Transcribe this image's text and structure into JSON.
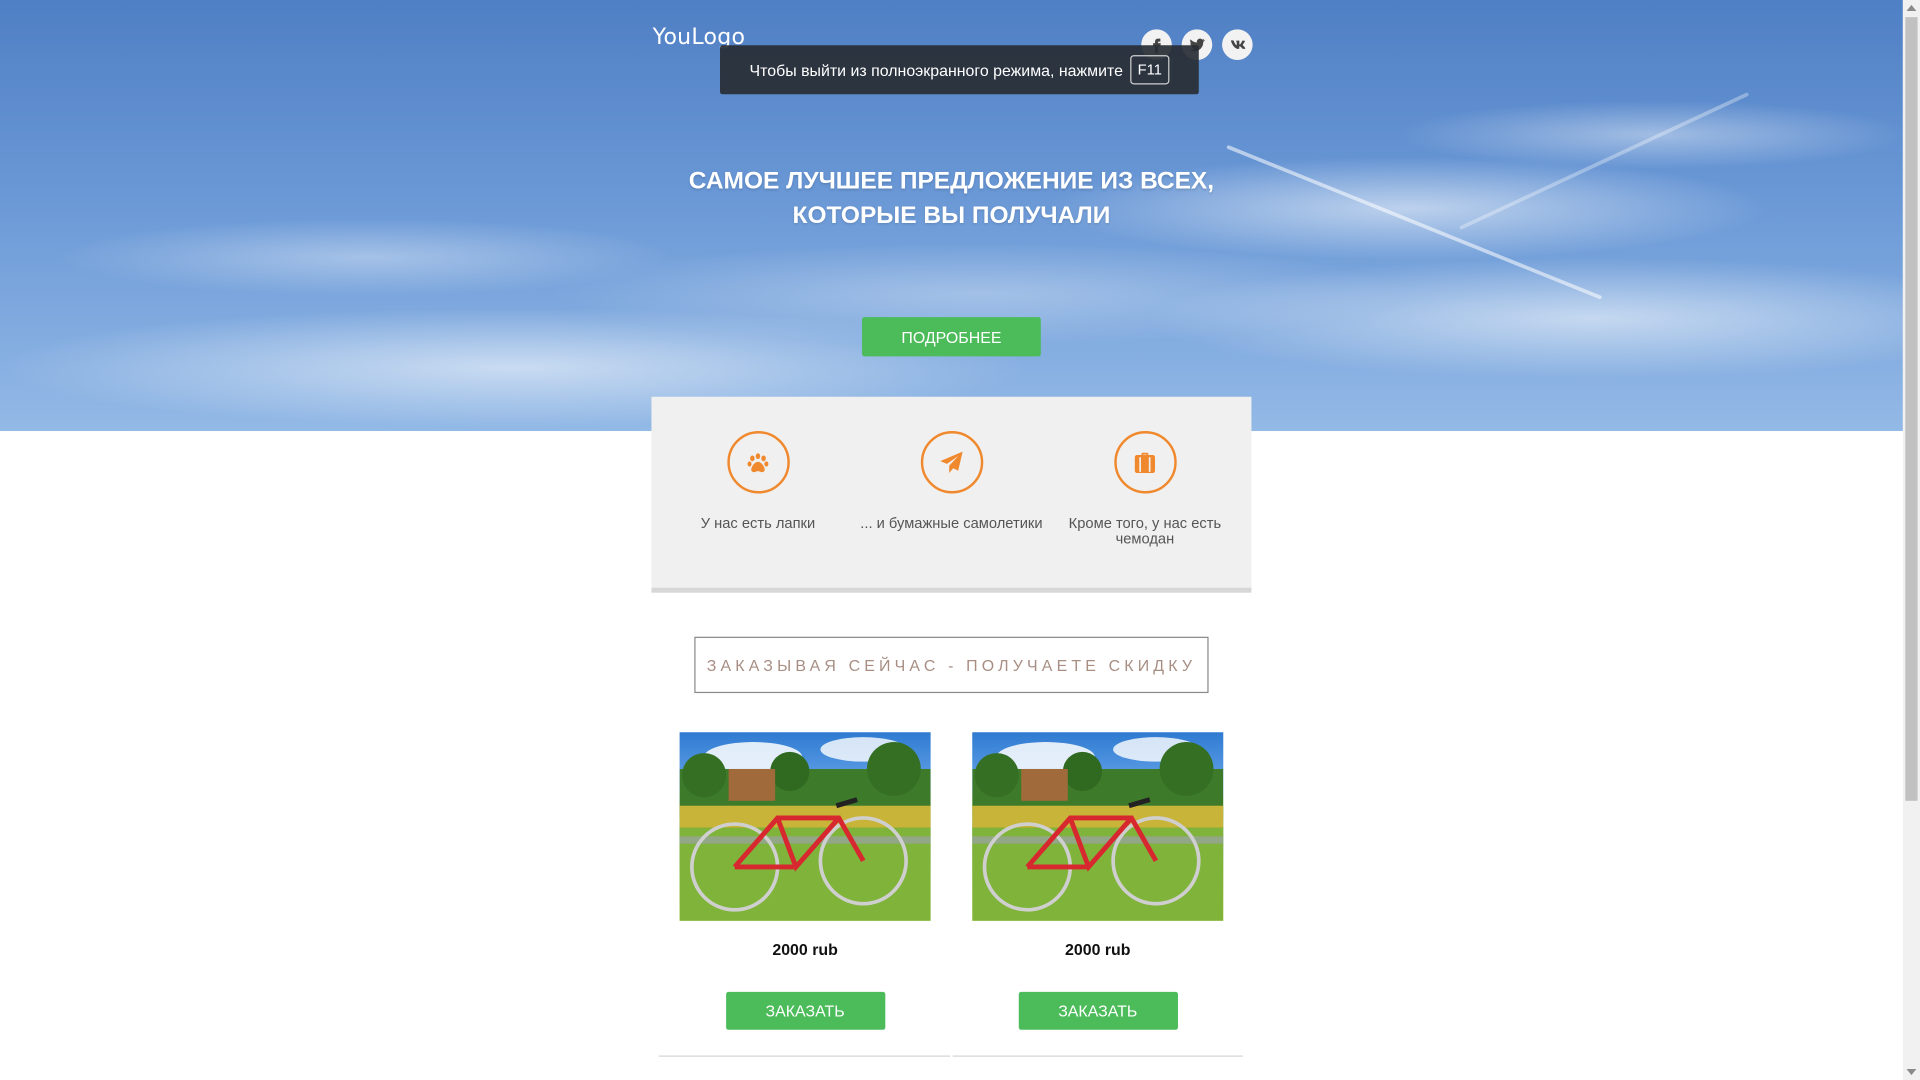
{
  "header": {
    "logo": "YouLogo",
    "social": [
      {
        "icon": "facebook-icon"
      },
      {
        "icon": "twitter-icon"
      },
      {
        "icon": "vk-icon"
      }
    ]
  },
  "fullscreen_notice": {
    "text": "Чтобы выйти из полноэкранного режима, нажмите",
    "key": "F11"
  },
  "hero": {
    "headline_line1": "САМОЕ ЛУЧШЕЕ ПРЕДЛОЖЕНИЕ ИЗ ВСЕХ,",
    "headline_line2": "КОТОРЫЕ ВЫ ПОЛУЧАЛИ",
    "button_label": "ПОДРОБНЕЕ"
  },
  "features": [
    {
      "icon": "paw-icon",
      "text": "У нас есть лапки"
    },
    {
      "icon": "paper-plane-icon",
      "text": "... и бумажные самолетики"
    },
    {
      "icon": "suitcase-icon",
      "text": "Кроме того, у нас есть чемодан"
    }
  ],
  "discount_banner": "ЗАКАЗЫВАЯ СЕЙЧАС - ПОЛУЧАЕТЕ СКИДКУ",
  "products": [
    {
      "image": "red-bicycle-photo",
      "price": "2000 rub",
      "button_label": "ЗАКАЗАТЬ"
    },
    {
      "image": "red-bicycle-photo",
      "price": "2000 rub",
      "button_label": "ЗАКАЗАТЬ"
    }
  ],
  "colors": {
    "accent_green": "#4cbb5a",
    "icon_orange": "#f0892d",
    "discount_text": "#a88e83",
    "sky_blue": "#6a98d6"
  }
}
